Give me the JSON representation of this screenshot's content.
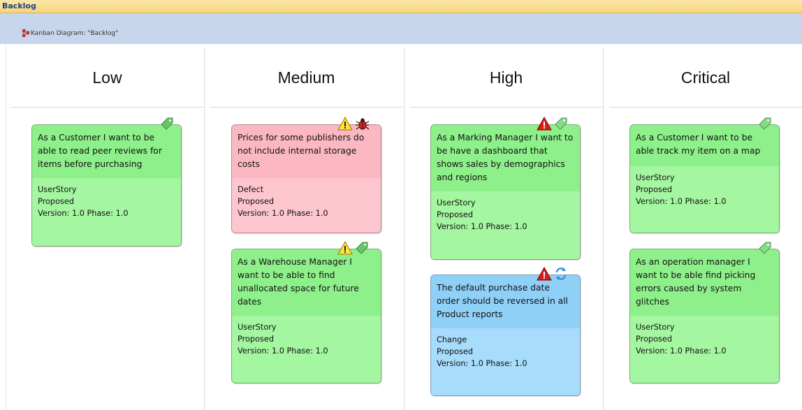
{
  "window": {
    "title": "Backlog"
  },
  "breadcrumb": {
    "label": "Kanban Diagram: \"Backlog\""
  },
  "lanes": [
    {
      "label": "Low"
    },
    {
      "label": "Medium"
    },
    {
      "label": "High"
    },
    {
      "label": "Critical"
    }
  ],
  "cards": [
    {
      "title": "As a Customer I want to be able to read peer reviews for items before purchasing",
      "type": "UserStory",
      "status": "Proposed",
      "version": "Version: 1.0 Phase: 1.0",
      "color": "#a4f6a0",
      "icons": [
        "tag-icon"
      ]
    },
    {
      "title": "Prices for some publishers do not include internal storage costs",
      "type": "Defect",
      "status": "Proposed",
      "version": "Version: 1.0 Phase: 1.0",
      "color": "#fdc6cf",
      "icons": [
        "warning-icon",
        "bug-icon"
      ]
    },
    {
      "title": "As a Warehouse Manager I want to be able to find unallocated space for future dates",
      "type": "UserStory",
      "status": "Proposed",
      "version": "Version: 1.0 Phase: 1.0",
      "color": "#a4f6a0",
      "icons": [
        "warning-icon",
        "tag-icon"
      ]
    },
    {
      "title": "As a Marking Manager I want to be have a dashboard that shows sales by demographics and regions",
      "type": "UserStory",
      "status": "Proposed",
      "version": "Version: 1.0 Phase: 1.0",
      "color": "#a4f6a0",
      "icons": [
        "critical-icon",
        "tag-icon"
      ]
    },
    {
      "title": "The default purchase date order should be reversed in all Product reports",
      "type": "Change",
      "status": "Proposed",
      "version": "Version: 1.0 Phase: 1.0",
      "color": "#a7dcfb",
      "icons": [
        "critical-icon",
        "change-icon"
      ]
    },
    {
      "title": "As a Customer I want to be able track my item on a map",
      "type": "UserStory",
      "status": "Proposed",
      "version": "Version: 1.0 Phase: 1.0",
      "color": "#a4f6a0",
      "icons": [
        "tag-icon"
      ]
    },
    {
      "title": "As an operation manager I want to be able find picking errors caused by system glitches",
      "type": "UserStory",
      "status": "Proposed",
      "version": "Version: 1.0 Phase: 1.0",
      "color": "#a4f6a0",
      "icons": [
        "tag-icon"
      ]
    }
  ]
}
